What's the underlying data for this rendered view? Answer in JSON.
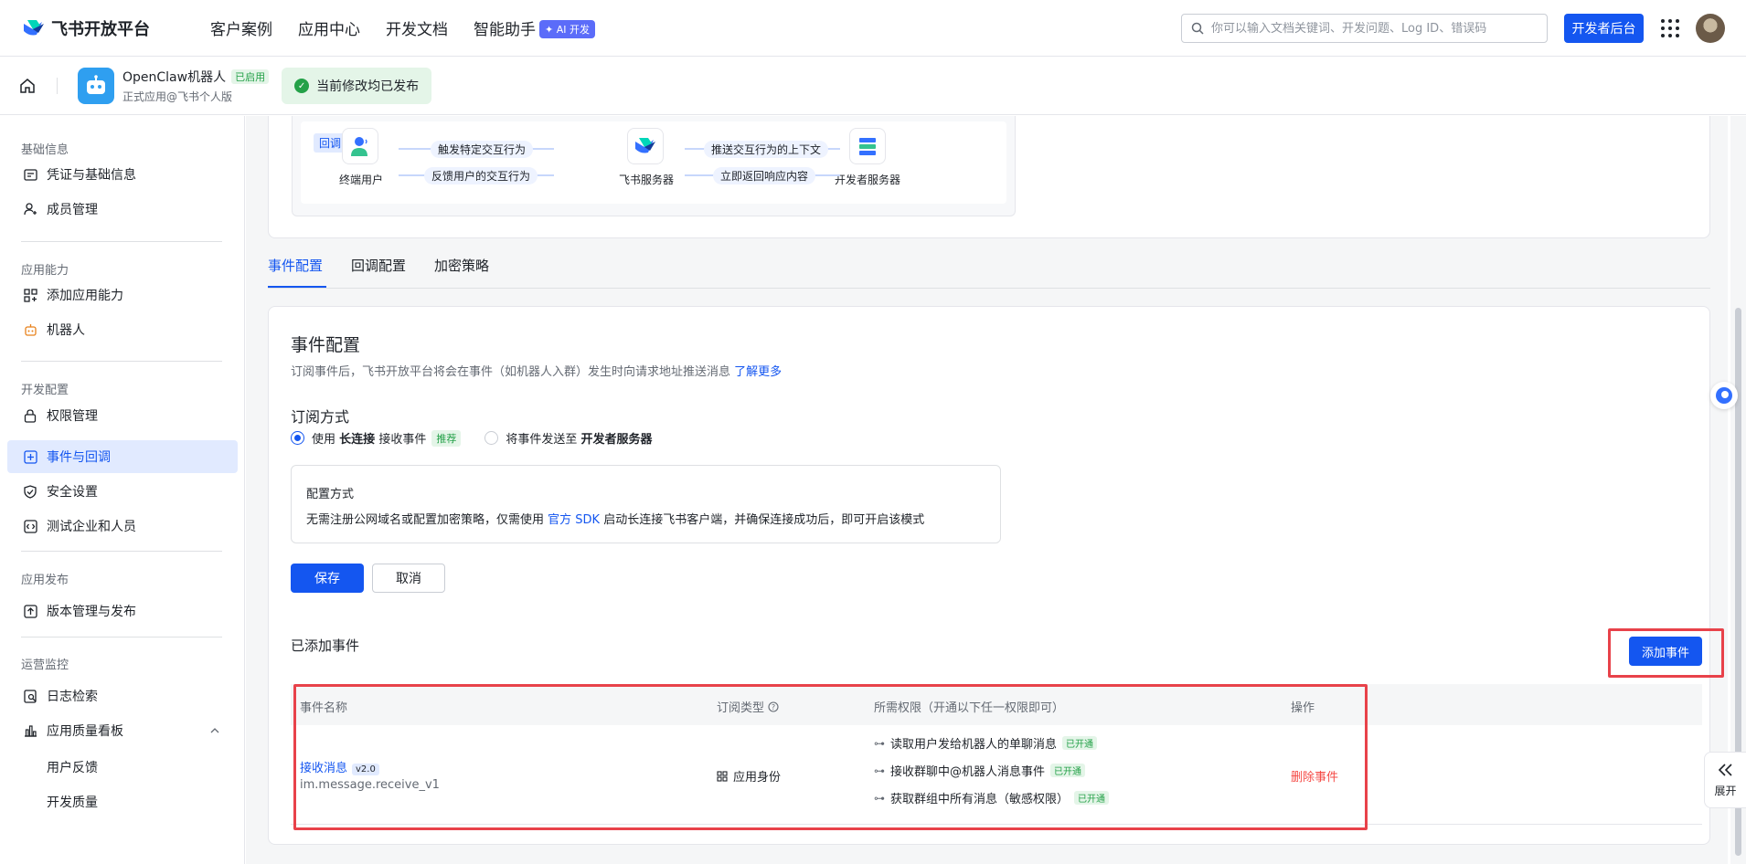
{
  "header": {
    "brand": "飞书开放平台",
    "nav": [
      {
        "label": "客户案例"
      },
      {
        "label": "应用中心"
      },
      {
        "label": "开发文档"
      },
      {
        "label": "智能助手"
      }
    ],
    "ai_badge": "✦ AI 开发",
    "search_placeholder": "你可以输入文档关键词、开发问题、Log ID、错误码",
    "dev_console_button": "开发者后台"
  },
  "appbar": {
    "app_name": "OpenClaw机器人",
    "status_tag": "已启用",
    "app_subtitle": "正式应用@飞书个人版",
    "publish_status": "当前修改均已发布"
  },
  "sidebar": {
    "sections": [
      {
        "title": "基础信息",
        "items": [
          "凭证与基础信息",
          "成员管理"
        ]
      },
      {
        "title": "应用能力",
        "items": [
          "添加应用能力",
          "机器人"
        ]
      },
      {
        "title": "开发配置",
        "items": [
          "权限管理",
          "事件与回调",
          "安全设置",
          "测试企业和人员"
        ]
      },
      {
        "title": "应用发布",
        "items": [
          "版本管理与发布"
        ]
      },
      {
        "title": "运营监控",
        "items": [
          "日志检索",
          "应用质量看板",
          "用户反馈",
          "开发质量"
        ]
      }
    ],
    "active_item": "事件与回调"
  },
  "flow": {
    "tag": "回调",
    "nodes": [
      "终端用户",
      "飞书服务器",
      "开发者服务器"
    ],
    "arrows": [
      "触发特定交互行为",
      "反馈用户的交互行为",
      "推送交互行为的上下文",
      "立即返回响应内容"
    ]
  },
  "tabs": [
    "事件配置",
    "回调配置",
    "加密策略"
  ],
  "config": {
    "title": "事件配置",
    "description": "订阅事件后，飞书开放平台将会在事件（如机器人入群）发生时向请求地址推送消息",
    "learn_more": "了解更多",
    "subscribe_title": "订阅方式",
    "option1_prefix": "使用",
    "option1_bold": "长连接",
    "option1_suffix": "接收事件",
    "option1_tag": "推荐",
    "option2_prefix": "将事件发送至",
    "option2_bold": "开发者服务器",
    "mode_title": "配置方式",
    "mode_desc_prefix": "无需注册公网域名或配置加密策略，仅需使用",
    "mode_desc_link": "官方 SDK",
    "mode_desc_suffix": "启动长连接飞书客户端，并确保连接成功后，即可开启该模式",
    "save": "保存",
    "cancel": "取消",
    "added_title": "已添加事件",
    "add_event": "添加事件"
  },
  "table": {
    "headers": [
      "事件名称",
      "订阅类型",
      "所需权限（开通以下任一权限即可）",
      "操作"
    ],
    "rows": [
      {
        "name": "接收消息",
        "version": "v2.0",
        "code": "im.message.receive_v1",
        "sub_type": "应用身份",
        "permissions": [
          {
            "label": "读取用户发给机器人的单聊消息",
            "status": "已开通"
          },
          {
            "label": "接收群聊中@机器人消息事件",
            "status": "已开通"
          },
          {
            "label": "获取群组中所有消息（敏感权限）",
            "status": "已开通"
          }
        ],
        "action": "删除事件"
      }
    ]
  },
  "expand_label": "展开",
  "colors": {
    "accent": "#1456f0",
    "success": "#24a148",
    "danger": "#f54a45",
    "highlight": "#e8424a"
  }
}
